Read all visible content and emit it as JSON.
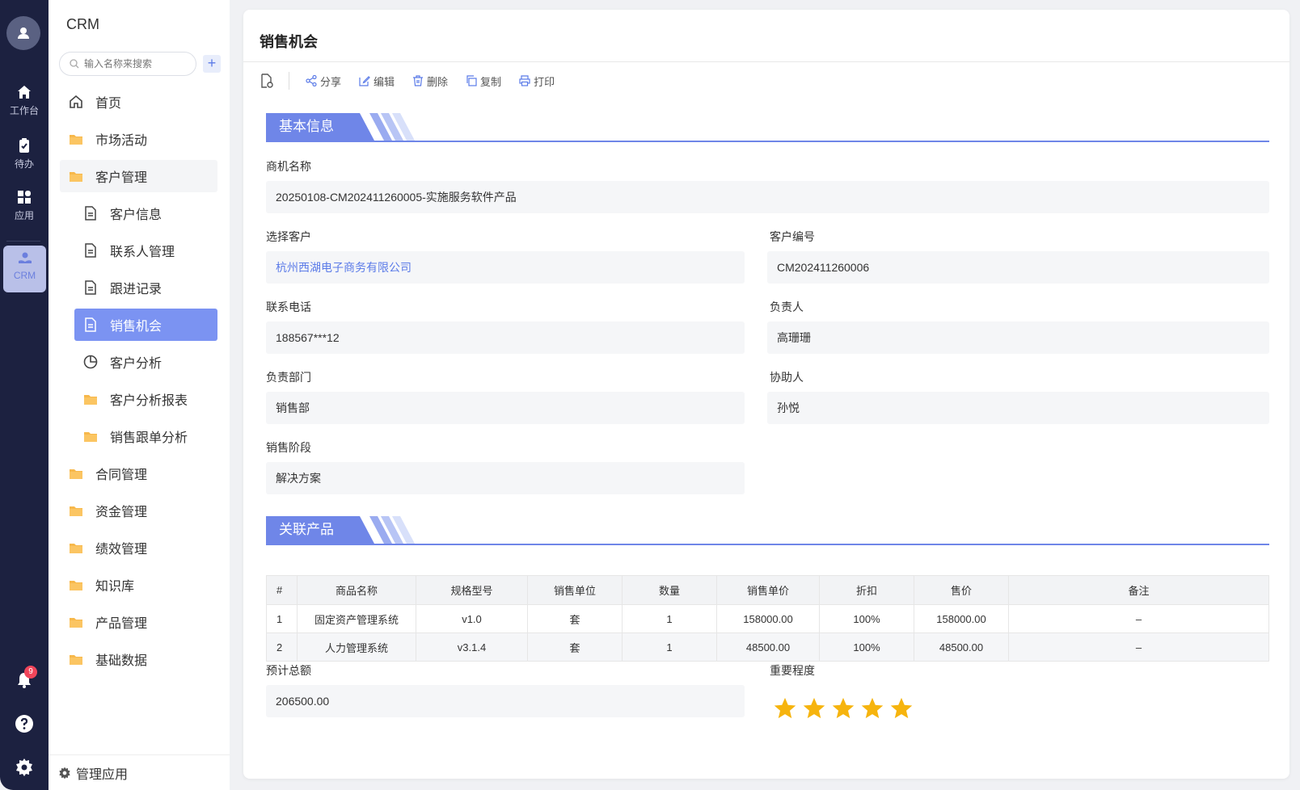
{
  "rail": {
    "items": [
      {
        "label": "工作台",
        "icon": "home-icon"
      },
      {
        "label": "待办",
        "icon": "clipboard-icon"
      },
      {
        "label": "应用",
        "icon": "apps-icon"
      },
      {
        "label": "CRM",
        "icon": "crm-icon"
      }
    ],
    "notification_count": "9"
  },
  "sidebar": {
    "title": "CRM",
    "search_placeholder": "输入名称来搜索",
    "add_label": "+",
    "items": [
      {
        "label": "首页",
        "icon": "home-outline-icon"
      },
      {
        "label": "市场活动",
        "icon": "folder-icon"
      },
      {
        "label": "客户管理",
        "icon": "folder-icon"
      },
      {
        "label": "客户信息",
        "icon": "document-icon"
      },
      {
        "label": "联系人管理",
        "icon": "document-icon"
      },
      {
        "label": "跟进记录",
        "icon": "document-icon"
      },
      {
        "label": "销售机会",
        "icon": "document-icon"
      },
      {
        "label": "客户分析",
        "icon": "pie-chart-icon"
      },
      {
        "label": "客户分析报表",
        "icon": "folder-icon"
      },
      {
        "label": "销售跟单分析",
        "icon": "folder-icon"
      },
      {
        "label": "合同管理",
        "icon": "folder-icon"
      },
      {
        "label": "资金管理",
        "icon": "folder-icon"
      },
      {
        "label": "绩效管理",
        "icon": "folder-icon"
      },
      {
        "label": "知识库",
        "icon": "folder-icon"
      },
      {
        "label": "产品管理",
        "icon": "folder-icon"
      },
      {
        "label": "基础数据",
        "icon": "folder-icon"
      }
    ],
    "footer_label": "管理应用"
  },
  "main": {
    "title": "销售机会",
    "toolbar": {
      "share": "分享",
      "edit": "编辑",
      "delete": "删除",
      "copy": "复制",
      "print": "打印"
    },
    "basic_section_title": "基本信息",
    "fields": {
      "opportunity_name_label": "商机名称",
      "opportunity_name": "20250108-CM202411260005-实施服务软件产品",
      "customer_label": "选择客户",
      "customer": "杭州西湖电子商务有限公司",
      "customer_no_label": "客户编号",
      "customer_no": "CM202411260006",
      "phone_label": "联系电话",
      "phone": "188567***12",
      "owner_label": "负责人",
      "owner": "高珊珊",
      "department_label": "负责部门",
      "department": "销售部",
      "assistant_label": "协助人",
      "assistant": "孙悦",
      "stage_label": "销售阶段",
      "stage": "解决方案"
    },
    "products_section_title": "关联产品",
    "products_table": {
      "headers": [
        "#",
        "商品名称",
        "规格型号",
        "销售单位",
        "数量",
        "销售单价",
        "折扣",
        "售价",
        "备注"
      ],
      "rows": [
        [
          "1",
          "固定资产管理系统",
          "v1.0",
          "套",
          "1",
          "158000.00",
          "100%",
          "158000.00",
          "–"
        ],
        [
          "2",
          "人力管理系统",
          "v3.1.4",
          "套",
          "1",
          "48500.00",
          "100%",
          "48500.00",
          "–"
        ]
      ]
    },
    "total_label": "预计总额",
    "total": "206500.00",
    "importance_label": "重要程度",
    "importance_stars": 5,
    "accent_color": "#6f86e8",
    "star_color": "#f6b40e"
  }
}
